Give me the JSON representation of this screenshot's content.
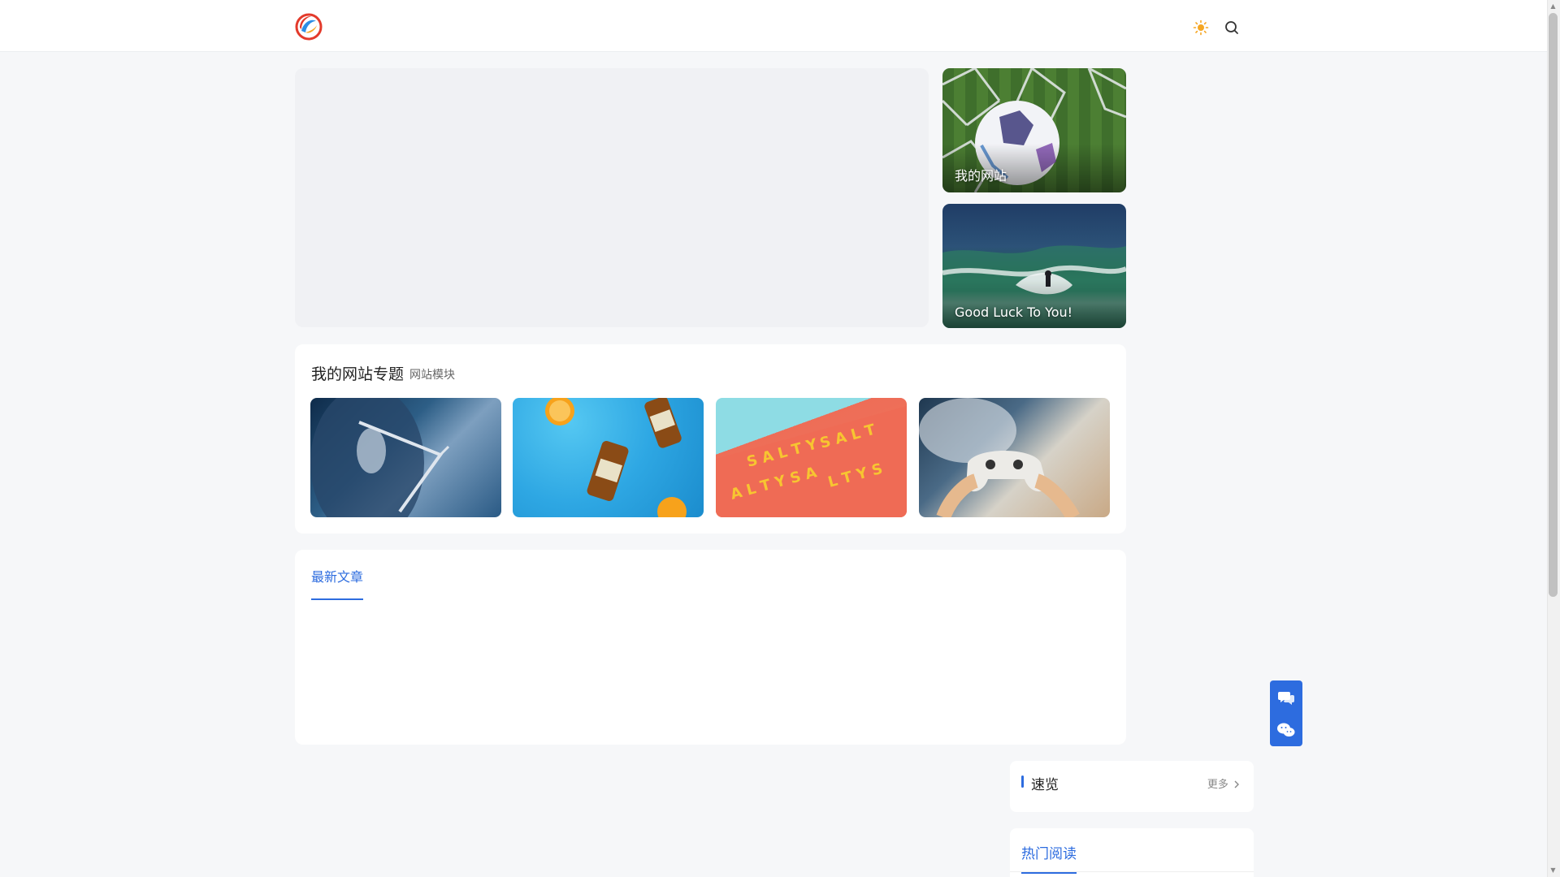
{
  "header": {
    "logo_icon": "site-logo",
    "theme_icon": "sun-icon",
    "search_icon": "search-icon"
  },
  "featured": {
    "cards": [
      {
        "label": "我的网站"
      },
      {
        "label": "Good Luck To You!"
      }
    ]
  },
  "topics": {
    "title": "我的网站专题",
    "subtitle": "网站模块"
  },
  "latest": {
    "tab_label": "最新文章"
  },
  "floating": {
    "items": [
      "chat-icon",
      "wechat-icon"
    ]
  },
  "sidebar": {
    "quick": {
      "title": "速览",
      "more": "更多",
      "more_icon": "chevron-right-icon"
    },
    "hot": {
      "title": "热门阅读"
    }
  },
  "colors": {
    "accent": "#2d6cdf",
    "theme_icon": "#f5a623"
  }
}
